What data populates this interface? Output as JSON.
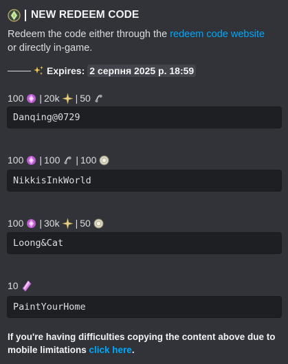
{
  "header": {
    "title": "NEW REDEEM CODE",
    "icon": "gem-badge-icon"
  },
  "description": {
    "before": "Redeem the code either through the ",
    "link": "redeem code website",
    "after": " or directly in-game."
  },
  "expires": {
    "label": "Expires:",
    "value": "2 серпня 2025 р. 18:59"
  },
  "codes": [
    {
      "rewards": [
        {
          "amount": "100",
          "icon": "diamond-icon"
        },
        {
          "amount": "20k",
          "icon": "star-icon"
        },
        {
          "amount": "50",
          "icon": "thread-icon"
        }
      ],
      "code": "Danqing@0729"
    },
    {
      "rewards": [
        {
          "amount": "100",
          "icon": "diamond-icon"
        },
        {
          "amount": "100",
          "icon": "thread-icon"
        },
        {
          "amount": "100",
          "icon": "orb-icon"
        }
      ],
      "code": "NikkisInkWorld"
    },
    {
      "rewards": [
        {
          "amount": "100",
          "icon": "diamond-icon"
        },
        {
          "amount": "30k",
          "icon": "star-icon"
        },
        {
          "amount": "50",
          "icon": "orb-icon"
        }
      ],
      "code": "Loong&Cat"
    },
    {
      "rewards": [
        {
          "amount": "10",
          "icon": "crystal-icon"
        }
      ],
      "code": "PaintYourHome"
    }
  ],
  "footer": {
    "text": "If you're having difficulties copying the content above due to mobile limitations ",
    "link": "click here",
    "after": "."
  },
  "colors": {
    "background": "#313338",
    "code_background": "#1e1f22",
    "link": "#00a8fc",
    "diamond": "#c86fd8",
    "star": "#e8d28a",
    "orb": "#d8d4c0"
  }
}
